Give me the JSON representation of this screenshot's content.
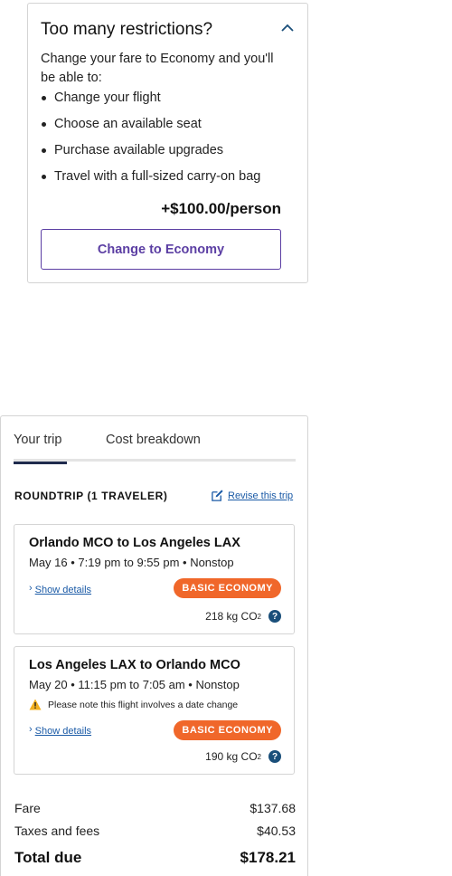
{
  "upsell": {
    "title": "Too many restrictions?",
    "intro": "Change your fare to Economy and you'll be able to:",
    "benefits": [
      "Change your flight",
      "Choose an available seat",
      "Purchase available upgrades",
      "Travel with a full-sized carry-on bag"
    ],
    "price": "+$100.00/person",
    "button_label": "Change to Economy"
  },
  "trip": {
    "tabs": [
      "Your trip",
      "Cost breakdown"
    ],
    "roundtrip_label": "ROUNDTRIP (1 TRAVELER)",
    "revise_label": "Revise this trip",
    "flights": [
      {
        "route": "Orlando MCO to Los Angeles LAX",
        "time": "May 16 • 7:19 pm to 9:55 pm • Nonstop",
        "details_label": "Show details",
        "fare_class": "BASIC ECONOMY",
        "co2_value": "218 kg CO",
        "co2_sub": "2"
      },
      {
        "route": "Los Angeles LAX to Orlando MCO",
        "time": "May 20 • 11:15 pm to 7:05 am • Nonstop",
        "note": "Please note this flight involves a date change",
        "details_label": "Show details",
        "fare_class": "BASIC ECONOMY",
        "co2_value": "190 kg CO",
        "co2_sub": "2"
      }
    ],
    "costs": {
      "fare_label": "Fare",
      "fare_value": "$137.68",
      "taxes_label": "Taxes and fees",
      "taxes_value": "$40.53",
      "total_label": "Total due",
      "total_value": "$178.21"
    }
  },
  "colors": {
    "accent_purple": "#5b3ea3",
    "badge_orange": "#f0672a",
    "link_blue": "#1a5aa6",
    "tab_indicator": "#1f2b4d"
  }
}
